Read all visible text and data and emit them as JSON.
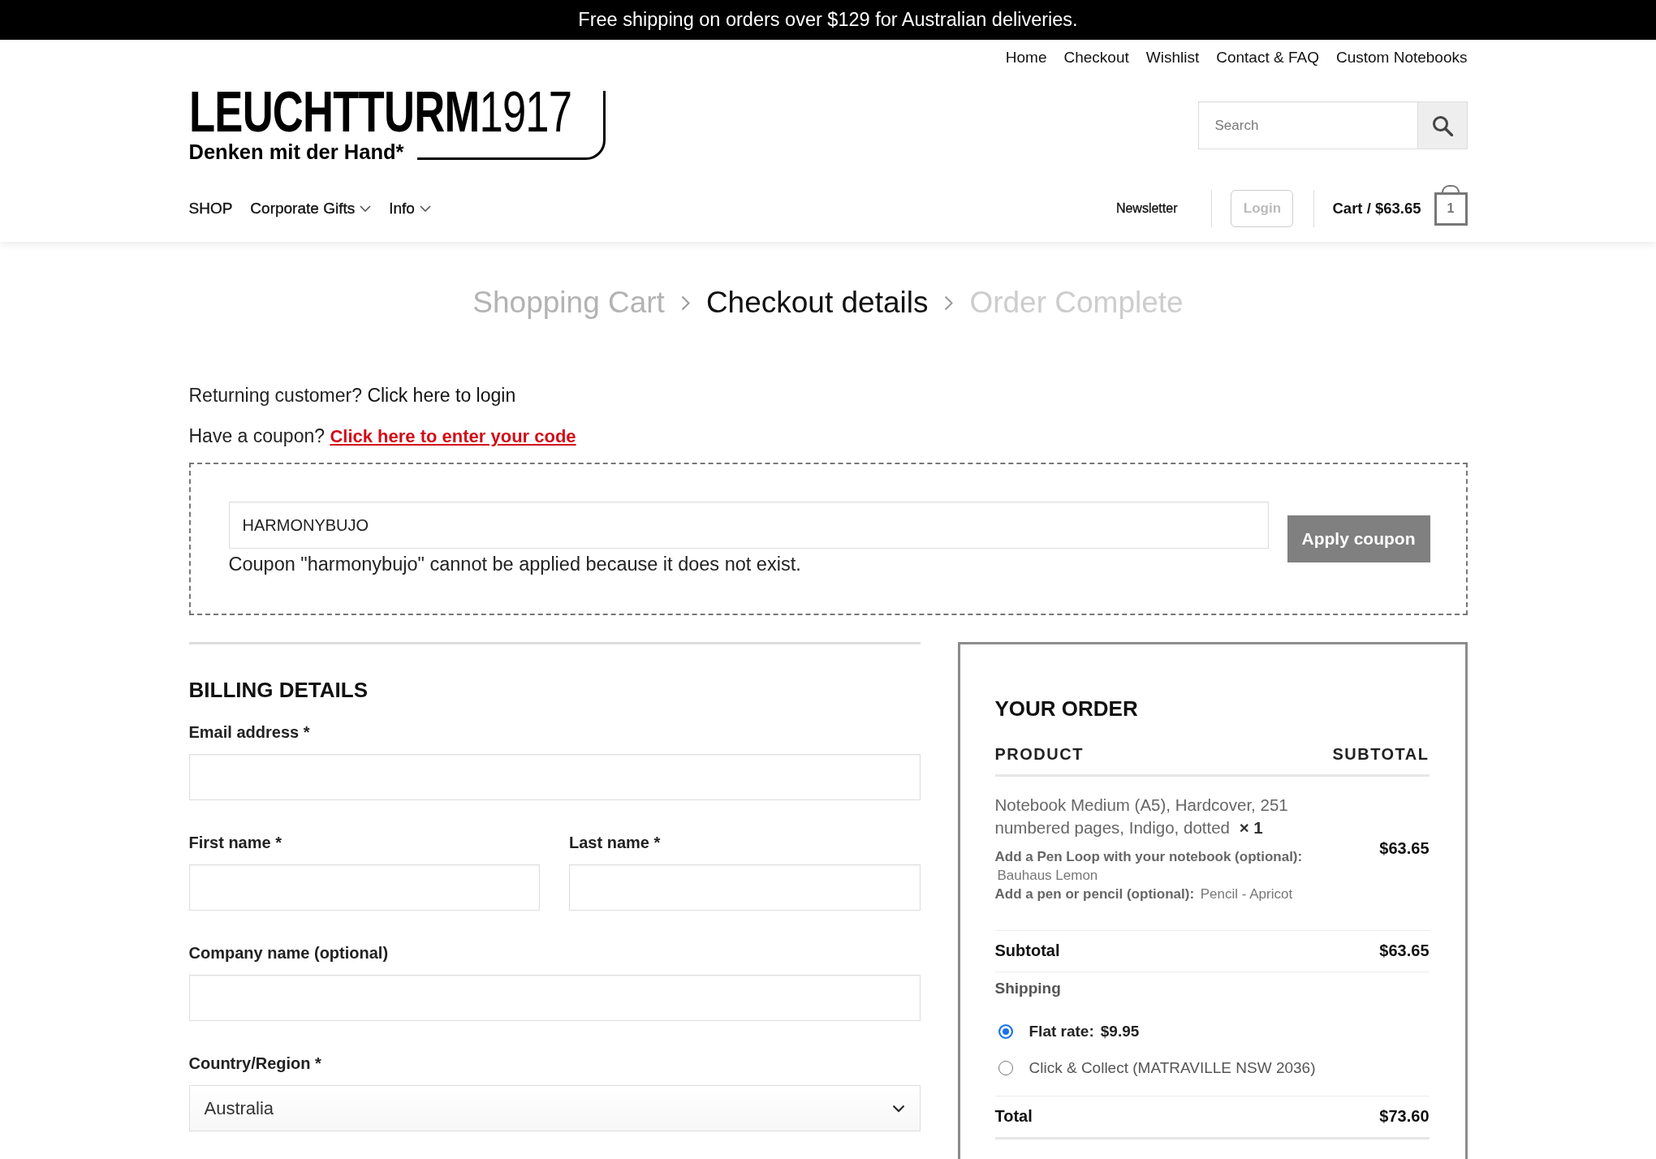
{
  "announcement_bar": {
    "text": "Free shipping on orders over $129 for Australian deliveries."
  },
  "top_nav": {
    "links": [
      "Home",
      "Checkout",
      "Wishlist",
      "Contact & FAQ",
      "Custom Notebooks"
    ]
  },
  "logo": {
    "wordmark": "**LEUCHTTURM**1917",
    "tagline": "Denken mit der Hand*"
  },
  "search": {
    "placeholder": "Search"
  },
  "main_nav": {
    "items": [
      {
        "label": "SHOP",
        "has_dropdown": false
      },
      {
        "label": "Corporate Gifts",
        "has_dropdown": true
      },
      {
        "label": "Info",
        "has_dropdown": true
      }
    ]
  },
  "account_nav": {
    "newsletter": "Newsletter",
    "login": "Login",
    "cart_label": "Cart / $63.65",
    "cart_count": "1"
  },
  "checkout_steps": [
    {
      "label": "Shopping Cart",
      "selected": false,
      "completed": true
    },
    {
      "label": "Checkout details",
      "selected": true,
      "completed": false
    },
    {
      "label": "Order Complete",
      "selected": false,
      "completed": false
    }
  ],
  "returning_customer": {
    "text": "Returning customer?",
    "link": "Click here to login"
  },
  "coupon_notice": {
    "text": "Have a coupon?",
    "link": "Click here to enter your code"
  },
  "coupon_form": {
    "value": "HARMONYBUJO",
    "error": "Coupon \"harmonybujo\" cannot be applied because it does not exist.",
    "button": "Apply coupon"
  },
  "billing": {
    "title": "BILLING DETAILS",
    "rows": [
      [
        {
          "label": "Email address *",
          "kind": "text"
        }
      ],
      [
        {
          "label": "First name *",
          "kind": "text"
        },
        {
          "label": "Last name *",
          "kind": "text"
        }
      ],
      [
        {
          "label": "Company name (optional)",
          "kind": "text"
        }
      ],
      [
        {
          "label": "Country/Region *",
          "kind": "select",
          "value": "Australia"
        }
      ]
    ]
  },
  "order": {
    "title": "YOUR ORDER",
    "columns": [
      "PRODUCT",
      "SUBTOTAL"
    ],
    "items": [
      {
        "name": "Notebook Medium (A5), Hardcover, 251 numbered pages, Indigo, dotted",
        "quantity": "× 1",
        "options": [
          {
            "label": "Add a Pen Loop with your notebook (optional):",
            "value": "Bauhaus Lemon"
          },
          {
            "label": "Add a pen or pencil (optional):",
            "value": "Pencil - Apricot"
          }
        ],
        "subtotal": "$63.65"
      }
    ],
    "subtotal": {
      "label": "Subtotal",
      "value": "$63.65"
    },
    "shipping": {
      "label": "Shipping",
      "options": [
        {
          "label": "Flat rate:",
          "price": "$9.95",
          "selected": true
        },
        {
          "label": "Click & Collect (MATRAVILLE NSW 2036)",
          "selected": false
        }
      ]
    },
    "total": {
      "label": "Total",
      "value": "$73.60"
    }
  }
}
